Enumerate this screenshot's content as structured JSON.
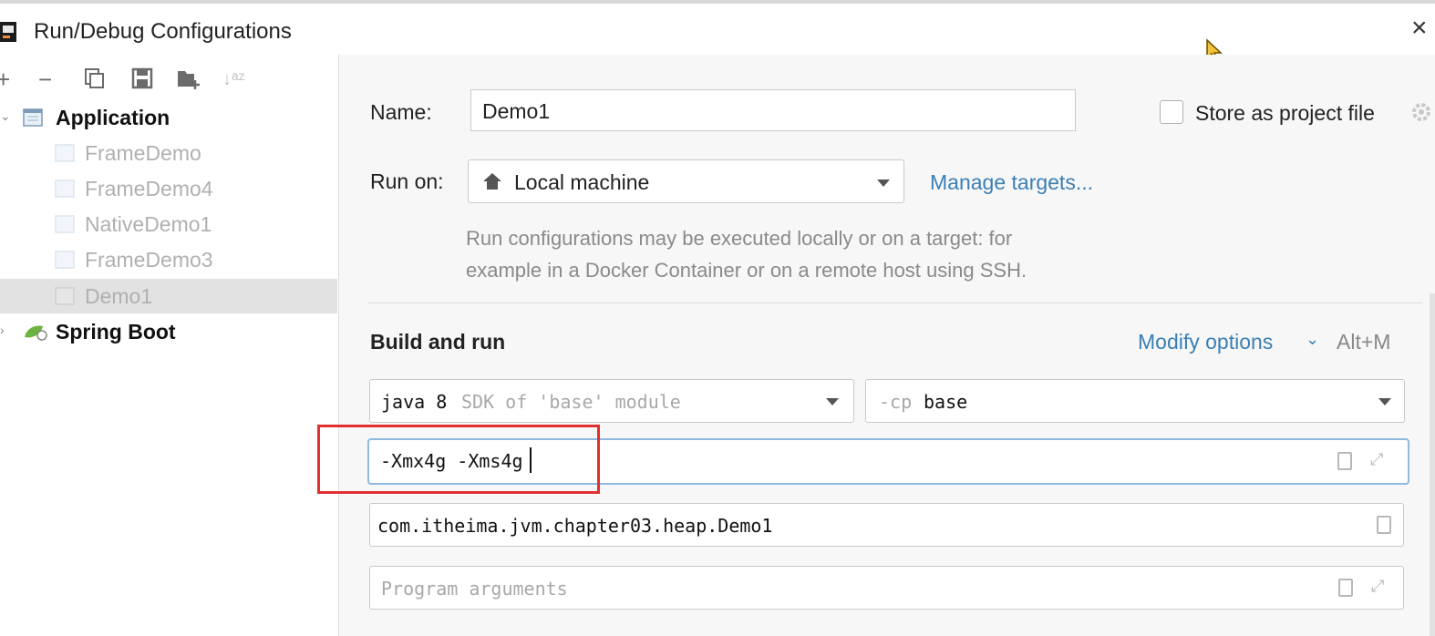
{
  "window": {
    "title": "Run/Debug Configurations",
    "close_glyph": "×"
  },
  "toolbar": {
    "icons": [
      "add-icon",
      "remove-icon",
      "copy-icon",
      "save-icon",
      "new-folder-icon",
      "sort-icon"
    ],
    "add_glyph": "+",
    "remove_glyph": "−",
    "sort_glyph": "↓ᵃᶻ"
  },
  "tree": {
    "application_label": "Application",
    "children": [
      "FrameDemo",
      "FrameDemo4",
      "NativeDemo1",
      "FrameDemo3",
      "Demo1"
    ],
    "selected": "Demo1",
    "spring_label": "Spring Boot",
    "expanded_arrow": "⌄",
    "collapsed_arrow": "›"
  },
  "form": {
    "name_label": "Name:",
    "name_value": "Demo1",
    "store_label": "Store as project file",
    "run_on_label": "Run on:",
    "run_on_value": "Local machine",
    "manage_targets": "Manage targets...",
    "hint_line1": "Run configurations may be executed locally or on a target: for",
    "hint_line2": "example in a Docker Container or on a remote host using SSH.",
    "build_run_title": "Build and run",
    "modify_options": "Modify options",
    "modify_shortcut": "Alt+M",
    "jdk_value": "java 8",
    "jdk_hint": "SDK of 'base' module",
    "cp_prefix": "-cp",
    "cp_value": "base",
    "vm_options": "-Xmx4g -Xms4g",
    "main_class": "com.itheima.jvm.chapter03.heap.Demo1",
    "program_args_placeholder": "Program arguments"
  },
  "colors": {
    "accent": "#3a7fb4",
    "highlight_box": "#e03030",
    "focus_border": "#8fb9de",
    "selection": "#e2e2e2"
  }
}
